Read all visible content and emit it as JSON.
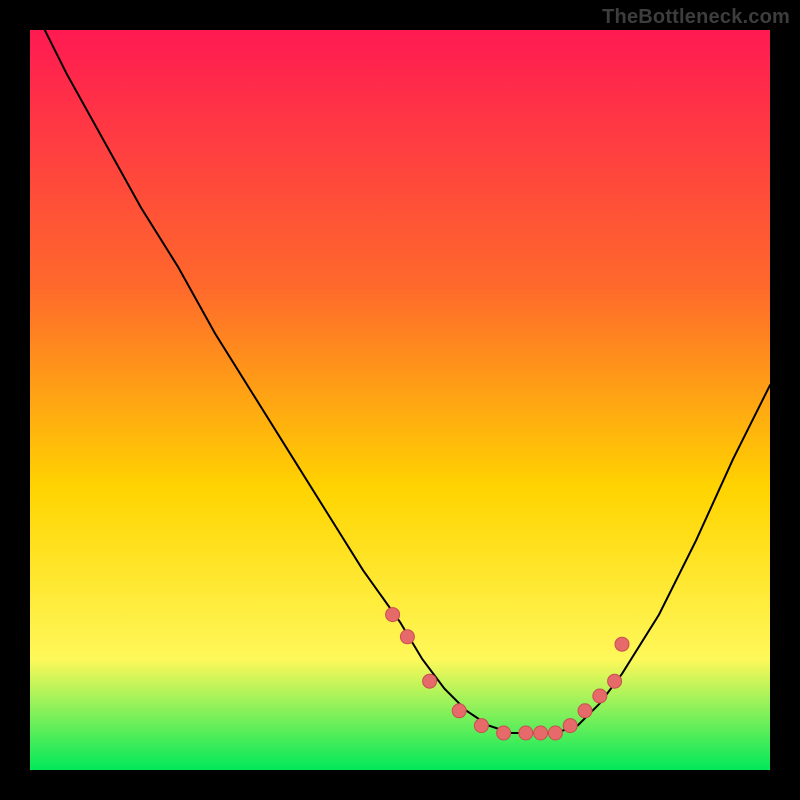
{
  "watermark": "TheBottleneck.com",
  "colors": {
    "gradient_top": "#ff1a52",
    "gradient_mid1": "#ff6a2b",
    "gradient_mid2": "#ffd400",
    "gradient_mid3": "#fff85a",
    "gradient_bottom": "#00e85a",
    "curve": "#000000",
    "marker_fill": "#e66a6a",
    "marker_stroke": "#c94f4f",
    "frame_bg": "#000000"
  },
  "chart_data": {
    "type": "line",
    "title": "",
    "xlabel": "",
    "ylabel": "",
    "xlim": [
      0,
      100
    ],
    "ylim": [
      0,
      100
    ],
    "grid": false,
    "legend": false,
    "series": [
      {
        "name": "bottleneck-curve",
        "x": [
          2,
          5,
          10,
          15,
          20,
          25,
          30,
          35,
          40,
          45,
          50,
          53,
          56,
          59,
          62,
          65,
          68,
          71,
          74,
          77,
          80,
          85,
          90,
          95,
          100
        ],
        "y": [
          100,
          94,
          85,
          76,
          68,
          59,
          51,
          43,
          35,
          27,
          20,
          15,
          11,
          8,
          6,
          5,
          5,
          5,
          6,
          9,
          13,
          21,
          31,
          42,
          52
        ]
      }
    ],
    "markers": {
      "name": "highlight-points",
      "x": [
        49,
        51,
        54,
        58,
        61,
        64,
        67,
        69,
        71,
        73,
        75,
        77,
        79,
        80
      ],
      "y": [
        21,
        18,
        12,
        8,
        6,
        5,
        5,
        5,
        5,
        6,
        8,
        10,
        12,
        17
      ]
    }
  }
}
